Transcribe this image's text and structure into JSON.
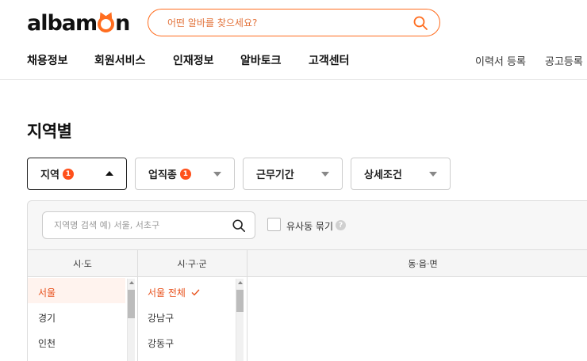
{
  "header": {
    "logo": "albamon",
    "search_placeholder": "어떤 알바를 찾으세요?",
    "nav": [
      "채용정보",
      "회원서비스",
      "인재정보",
      "알바토크",
      "고객센터"
    ],
    "right_links": [
      "이력서 등록",
      "공고등록"
    ]
  },
  "page_title": "지역별",
  "filters": [
    {
      "label": "지역",
      "badge": "1",
      "active": true
    },
    {
      "label": "업직종",
      "badge": "1",
      "active": false
    },
    {
      "label": "근무기간",
      "badge": "",
      "active": false
    },
    {
      "label": "상세조건",
      "badge": "",
      "active": false
    }
  ],
  "panel": {
    "search_placeholder": "지역명 검색 예) 서울, 서초구",
    "checkbox_label": "유사동 묶기",
    "help_mark": "?",
    "columns": [
      "시·도",
      "시·구·군",
      "동·읍·면"
    ],
    "provinces": [
      "서울",
      "경기",
      "인천"
    ],
    "districts": [
      "서울 전체",
      "강남구",
      "강동구"
    ],
    "selected_province": "서울",
    "selected_district": "서울 전체"
  },
  "colors": {
    "accent": "#ff6d1f",
    "badge": "#ff501b",
    "selected_text": "#e8521d"
  }
}
